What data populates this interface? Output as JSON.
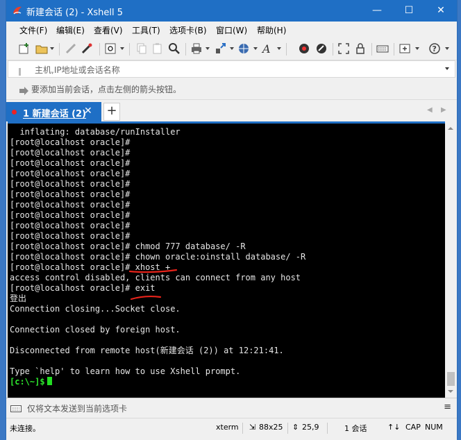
{
  "window": {
    "title": "新建会话 (2) - Xshell 5",
    "minimize": "—",
    "maximize": "☐",
    "close": "✕"
  },
  "menu": [
    "文件(F)",
    "编辑(E)",
    "查看(V)",
    "工具(T)",
    "选项卡(B)",
    "窗口(W)",
    "帮助(H)"
  ],
  "address": {
    "placeholder": "主机,IP地址或会话名称"
  },
  "hint": {
    "text": "要添加当前会话，点击左侧的箭头按钮。"
  },
  "tab": {
    "label": "1 新建会话 (2)",
    "close": "✕",
    "add": "+",
    "prev": "◀",
    "next": "▶"
  },
  "terminal": {
    "lines": [
      "  inflating: database/runInstaller",
      "[root@localhost oracle]#",
      "[root@localhost oracle]#",
      "[root@localhost oracle]#",
      "[root@localhost oracle]#",
      "[root@localhost oracle]#",
      "[root@localhost oracle]#",
      "[root@localhost oracle]#",
      "[root@localhost oracle]#",
      "[root@localhost oracle]#",
      "[root@localhost oracle]#",
      "[root@localhost oracle]# chmod 777 database/ -R",
      "[root@localhost oracle]# chown oracle:oinstall database/ -R",
      "[root@localhost oracle]# xhost +",
      "access control disabled, clients can connect from any host",
      "[root@localhost oracle]# exit",
      "登出",
      "Connection closing...Socket close.",
      "",
      "Connection closed by foreign host.",
      "",
      "Disconnected from remote host(新建会话 (2)) at 12:21:41.",
      "",
      "Type `help' to learn how to use Xshell prompt."
    ],
    "prompt": "[c:\\~]$"
  },
  "send_bar": {
    "text": "仅将文本发送到当前选项卡",
    "menu": "≡"
  },
  "status": {
    "connection": "未连接。",
    "terminal_type": "xterm",
    "size": "88x25",
    "cursor_pos": "25,9",
    "sessions": "1 会话",
    "caps": "CAP",
    "num": "NUM"
  },
  "colors": {
    "titlebar": "#1f6fc5",
    "terminal_bg": "#000000",
    "prompt_green": "#2ee82e",
    "annotation_red": "#e8231a"
  }
}
